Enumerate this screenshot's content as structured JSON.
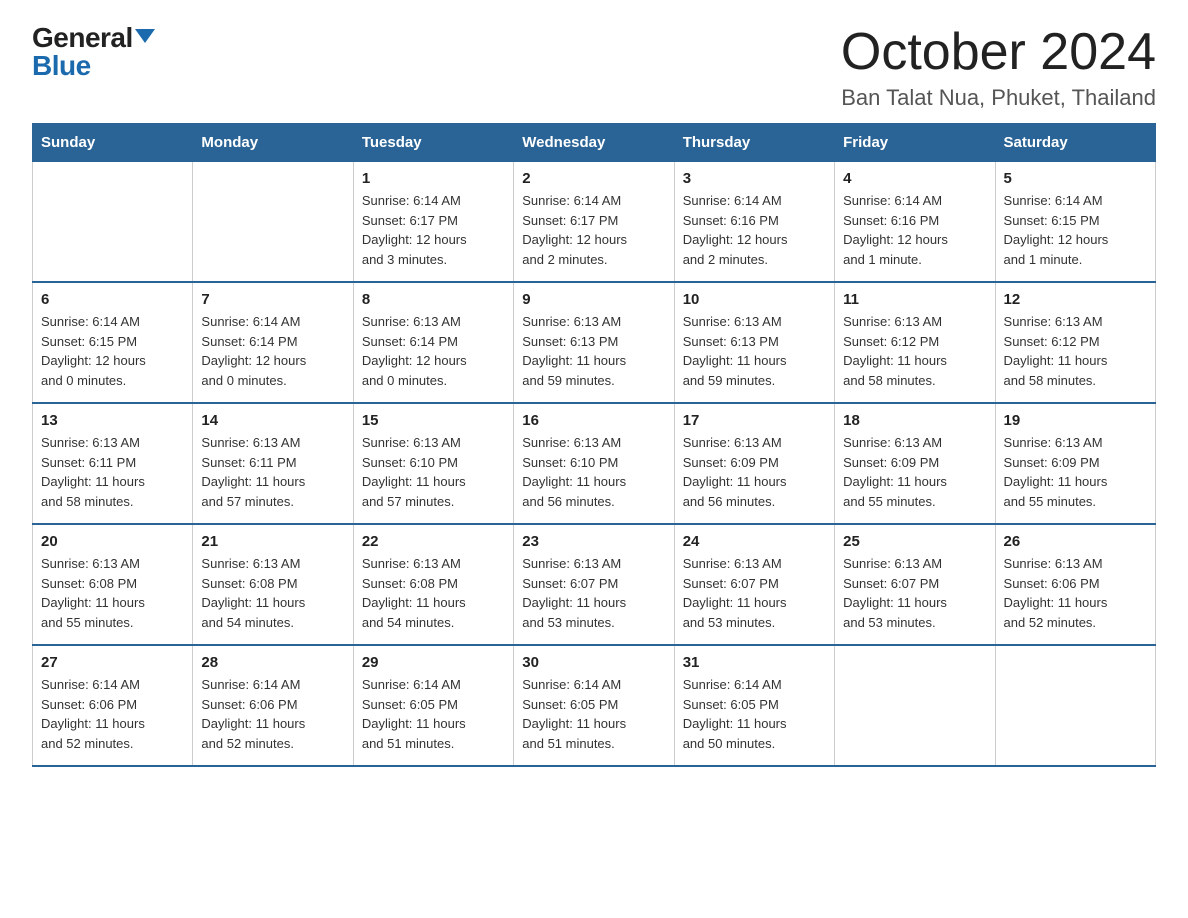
{
  "logo": {
    "general": "General",
    "triangle": "▲",
    "blue": "Blue"
  },
  "title": "October 2024",
  "location": "Ban Talat Nua, Phuket, Thailand",
  "days_of_week": [
    "Sunday",
    "Monday",
    "Tuesday",
    "Wednesday",
    "Thursday",
    "Friday",
    "Saturday"
  ],
  "weeks": [
    [
      {
        "day": "",
        "info": ""
      },
      {
        "day": "",
        "info": ""
      },
      {
        "day": "1",
        "info": "Sunrise: 6:14 AM\nSunset: 6:17 PM\nDaylight: 12 hours\nand 3 minutes."
      },
      {
        "day": "2",
        "info": "Sunrise: 6:14 AM\nSunset: 6:17 PM\nDaylight: 12 hours\nand 2 minutes."
      },
      {
        "day": "3",
        "info": "Sunrise: 6:14 AM\nSunset: 6:16 PM\nDaylight: 12 hours\nand 2 minutes."
      },
      {
        "day": "4",
        "info": "Sunrise: 6:14 AM\nSunset: 6:16 PM\nDaylight: 12 hours\nand 1 minute."
      },
      {
        "day": "5",
        "info": "Sunrise: 6:14 AM\nSunset: 6:15 PM\nDaylight: 12 hours\nand 1 minute."
      }
    ],
    [
      {
        "day": "6",
        "info": "Sunrise: 6:14 AM\nSunset: 6:15 PM\nDaylight: 12 hours\nand 0 minutes."
      },
      {
        "day": "7",
        "info": "Sunrise: 6:14 AM\nSunset: 6:14 PM\nDaylight: 12 hours\nand 0 minutes."
      },
      {
        "day": "8",
        "info": "Sunrise: 6:13 AM\nSunset: 6:14 PM\nDaylight: 12 hours\nand 0 minutes."
      },
      {
        "day": "9",
        "info": "Sunrise: 6:13 AM\nSunset: 6:13 PM\nDaylight: 11 hours\nand 59 minutes."
      },
      {
        "day": "10",
        "info": "Sunrise: 6:13 AM\nSunset: 6:13 PM\nDaylight: 11 hours\nand 59 minutes."
      },
      {
        "day": "11",
        "info": "Sunrise: 6:13 AM\nSunset: 6:12 PM\nDaylight: 11 hours\nand 58 minutes."
      },
      {
        "day": "12",
        "info": "Sunrise: 6:13 AM\nSunset: 6:12 PM\nDaylight: 11 hours\nand 58 minutes."
      }
    ],
    [
      {
        "day": "13",
        "info": "Sunrise: 6:13 AM\nSunset: 6:11 PM\nDaylight: 11 hours\nand 58 minutes."
      },
      {
        "day": "14",
        "info": "Sunrise: 6:13 AM\nSunset: 6:11 PM\nDaylight: 11 hours\nand 57 minutes."
      },
      {
        "day": "15",
        "info": "Sunrise: 6:13 AM\nSunset: 6:10 PM\nDaylight: 11 hours\nand 57 minutes."
      },
      {
        "day": "16",
        "info": "Sunrise: 6:13 AM\nSunset: 6:10 PM\nDaylight: 11 hours\nand 56 minutes."
      },
      {
        "day": "17",
        "info": "Sunrise: 6:13 AM\nSunset: 6:09 PM\nDaylight: 11 hours\nand 56 minutes."
      },
      {
        "day": "18",
        "info": "Sunrise: 6:13 AM\nSunset: 6:09 PM\nDaylight: 11 hours\nand 55 minutes."
      },
      {
        "day": "19",
        "info": "Sunrise: 6:13 AM\nSunset: 6:09 PM\nDaylight: 11 hours\nand 55 minutes."
      }
    ],
    [
      {
        "day": "20",
        "info": "Sunrise: 6:13 AM\nSunset: 6:08 PM\nDaylight: 11 hours\nand 55 minutes."
      },
      {
        "day": "21",
        "info": "Sunrise: 6:13 AM\nSunset: 6:08 PM\nDaylight: 11 hours\nand 54 minutes."
      },
      {
        "day": "22",
        "info": "Sunrise: 6:13 AM\nSunset: 6:08 PM\nDaylight: 11 hours\nand 54 minutes."
      },
      {
        "day": "23",
        "info": "Sunrise: 6:13 AM\nSunset: 6:07 PM\nDaylight: 11 hours\nand 53 minutes."
      },
      {
        "day": "24",
        "info": "Sunrise: 6:13 AM\nSunset: 6:07 PM\nDaylight: 11 hours\nand 53 minutes."
      },
      {
        "day": "25",
        "info": "Sunrise: 6:13 AM\nSunset: 6:07 PM\nDaylight: 11 hours\nand 53 minutes."
      },
      {
        "day": "26",
        "info": "Sunrise: 6:13 AM\nSunset: 6:06 PM\nDaylight: 11 hours\nand 52 minutes."
      }
    ],
    [
      {
        "day": "27",
        "info": "Sunrise: 6:14 AM\nSunset: 6:06 PM\nDaylight: 11 hours\nand 52 minutes."
      },
      {
        "day": "28",
        "info": "Sunrise: 6:14 AM\nSunset: 6:06 PM\nDaylight: 11 hours\nand 52 minutes."
      },
      {
        "day": "29",
        "info": "Sunrise: 6:14 AM\nSunset: 6:05 PM\nDaylight: 11 hours\nand 51 minutes."
      },
      {
        "day": "30",
        "info": "Sunrise: 6:14 AM\nSunset: 6:05 PM\nDaylight: 11 hours\nand 51 minutes."
      },
      {
        "day": "31",
        "info": "Sunrise: 6:14 AM\nSunset: 6:05 PM\nDaylight: 11 hours\nand 50 minutes."
      },
      {
        "day": "",
        "info": ""
      },
      {
        "day": "",
        "info": ""
      }
    ]
  ]
}
